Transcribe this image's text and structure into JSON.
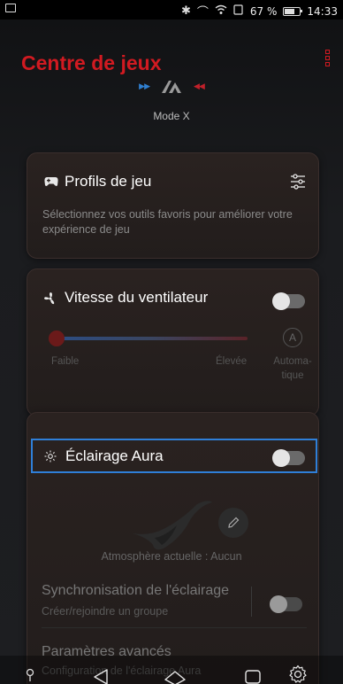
{
  "status_bar": {
    "battery_percent": "67 %",
    "battery_level": 0.67,
    "time": "14:33",
    "icons": [
      "image-notification-icon",
      "bluetooth-icon",
      "vibrate-icon",
      "wifi-icon",
      "battery-saver-icon",
      "battery-icon"
    ]
  },
  "header": {
    "title": "Centre de jeux",
    "menu_icon": "menu-icon"
  },
  "mode": {
    "label": "Mode X"
  },
  "game_profiles": {
    "title": "Profils de jeu",
    "description": "Sélectionnez vos outils favoris pour améliorer votre expérience de jeu",
    "icon": "gamepad-icon",
    "settings_icon": "sliders-icon"
  },
  "fan": {
    "title": "Vitesse du ventilateur",
    "icon": "fan-icon",
    "enabled": false,
    "slider_level": 0,
    "low_label": "Faible",
    "high_label": "Élevée",
    "auto_badge": "A",
    "auto_label_1": "Automa-",
    "auto_label_2": "tique"
  },
  "aura": {
    "title": "Éclairage Aura",
    "icon": "brightness-icon",
    "enabled": false,
    "current_atmosphere": "Atmosphère actuelle : Aucun",
    "sync_title": "Synchronisation de l'éclairage",
    "sync_subtitle": "Créer/rejoindre un groupe",
    "sync_enabled": false,
    "advanced_title": "Paramètres avancés",
    "advanced_subtitle": "Configuration de l'éclairage Aura"
  },
  "nav": {
    "back": "back-icon",
    "home": "home-icon",
    "recents": "recents-icon",
    "settings": "settings-gear-icon",
    "location": "location-pin-icon"
  },
  "colors": {
    "accent_red": "#d11a21",
    "highlight_blue": "#2f7fd8"
  }
}
